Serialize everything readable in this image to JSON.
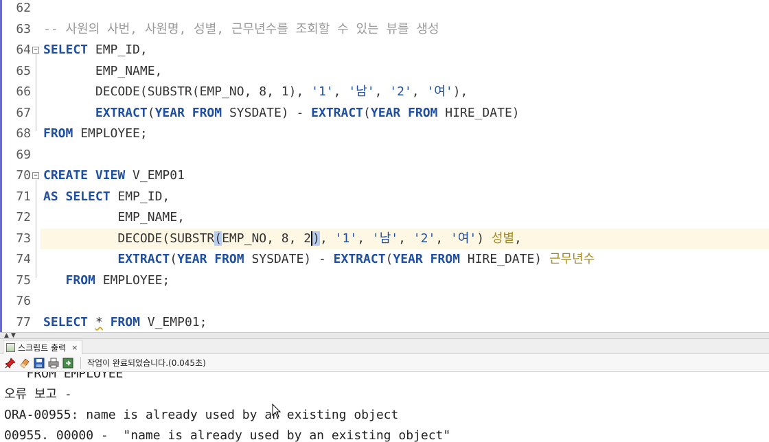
{
  "editor": {
    "lines": [
      {
        "n": "62",
        "segs": []
      },
      {
        "n": "63",
        "segs": [
          {
            "t": "-- 사원의 사번, 사원명, 성별, 근무년수를 조회할 수 있는 뷰를 생성",
            "c": "cmt"
          }
        ]
      },
      {
        "n": "64",
        "fold": true,
        "segs": [
          {
            "t": "SELECT",
            "c": "kw"
          },
          {
            "t": " EMP_ID,"
          }
        ]
      },
      {
        "n": "65",
        "segs": [
          {
            "t": "       EMP_NAME,"
          }
        ]
      },
      {
        "n": "66",
        "segs": [
          {
            "t": "       DECODE(SUBSTR(EMP_NO, 8, 1), "
          },
          {
            "t": "'1'",
            "c": "str"
          },
          {
            "t": ", "
          },
          {
            "t": "'남'",
            "c": "str"
          },
          {
            "t": ", "
          },
          {
            "t": "'2'",
            "c": "str"
          },
          {
            "t": ", "
          },
          {
            "t": "'여'",
            "c": "str"
          },
          {
            "t": "),"
          }
        ]
      },
      {
        "n": "67",
        "segs": [
          {
            "t": "       "
          },
          {
            "t": "EXTRACT",
            "c": "kw"
          },
          {
            "t": "("
          },
          {
            "t": "YEAR FROM",
            "c": "kw"
          },
          {
            "t": " SYSDATE) - "
          },
          {
            "t": "EXTRACT",
            "c": "kw"
          },
          {
            "t": "("
          },
          {
            "t": "YEAR FROM",
            "c": "kw"
          },
          {
            "t": " HIRE_DATE)"
          }
        ]
      },
      {
        "n": "68",
        "segs": [
          {
            "t": "FROM",
            "c": "kw"
          },
          {
            "t": " EMPLOYEE;"
          }
        ]
      },
      {
        "n": "69",
        "segs": []
      },
      {
        "n": "70",
        "fold": true,
        "segs": [
          {
            "t": "CREATE VIEW",
            "c": "kw"
          },
          {
            "t": " V_EMP01"
          }
        ]
      },
      {
        "n": "71",
        "segs": [
          {
            "t": "AS SELECT",
            "c": "kw"
          },
          {
            "t": " EMP_ID,"
          }
        ]
      },
      {
        "n": "72",
        "segs": [
          {
            "t": "          EMP_NAME,"
          }
        ]
      },
      {
        "n": "73",
        "current": true,
        "segs": [
          {
            "t": "          DECODE(SUBSTR"
          },
          {
            "t": "(",
            "c": "bm"
          },
          {
            "t": "EMP_NO, 8, 2"
          },
          {
            "t": ")",
            "c": "bm cur"
          },
          {
            "t": ", "
          },
          {
            "t": "'1'",
            "c": "str"
          },
          {
            "t": ", "
          },
          {
            "t": "'남'",
            "c": "str"
          },
          {
            "t": ", "
          },
          {
            "t": "'2'",
            "c": "str"
          },
          {
            "t": ", "
          },
          {
            "t": "'여'",
            "c": "str"
          },
          {
            "t": ") "
          },
          {
            "t": "성별",
            "c": "alias"
          },
          {
            "t": ","
          }
        ]
      },
      {
        "n": "74",
        "segs": [
          {
            "t": "          "
          },
          {
            "t": "EXTRACT",
            "c": "kw"
          },
          {
            "t": "("
          },
          {
            "t": "YEAR FROM",
            "c": "kw"
          },
          {
            "t": " SYSDATE) - "
          },
          {
            "t": "EXTRACT",
            "c": "kw"
          },
          {
            "t": "("
          },
          {
            "t": "YEAR FROM",
            "c": "kw"
          },
          {
            "t": " HIRE_DATE) "
          },
          {
            "t": "근무년수",
            "c": "alias"
          }
        ]
      },
      {
        "n": "75",
        "segs": [
          {
            "t": "   "
          },
          {
            "t": "FROM",
            "c": "kw"
          },
          {
            "t": " EMPLOYEE;"
          }
        ]
      },
      {
        "n": "76",
        "segs": []
      },
      {
        "n": "77",
        "segs": [
          {
            "t": "SELECT",
            "c": "kw"
          },
          {
            "t": " "
          },
          {
            "t": "*",
            "c": "wav"
          },
          {
            "t": " "
          },
          {
            "t": "FROM",
            "c": "kw"
          },
          {
            "t": " V_EMP01;"
          }
        ]
      }
    ]
  },
  "panel": {
    "tab_label": "스크립트 출력",
    "tab_close": "×",
    "status": "작업이 완료되었습니다.(0.045초)"
  },
  "output": {
    "lines": [
      "   FROM EMPLOYEE",
      "오류 보고 -",
      "ORA-00955: name is already used by an existing object",
      "00955. 00000 -  \"name is already used by an existing object\""
    ]
  },
  "icons": {
    "pin": "pin-icon",
    "eraser": "eraser-icon",
    "save": "save-icon",
    "print": "print-icon",
    "export": "export-icon",
    "script_tab": "script-output-icon"
  },
  "colors": {
    "keyword": "#1f4fa0",
    "comment": "#9a9a9a",
    "alias": "#a58a1c",
    "current_line": "#fdf7e3",
    "bracket_match": "#b9cdf0"
  }
}
